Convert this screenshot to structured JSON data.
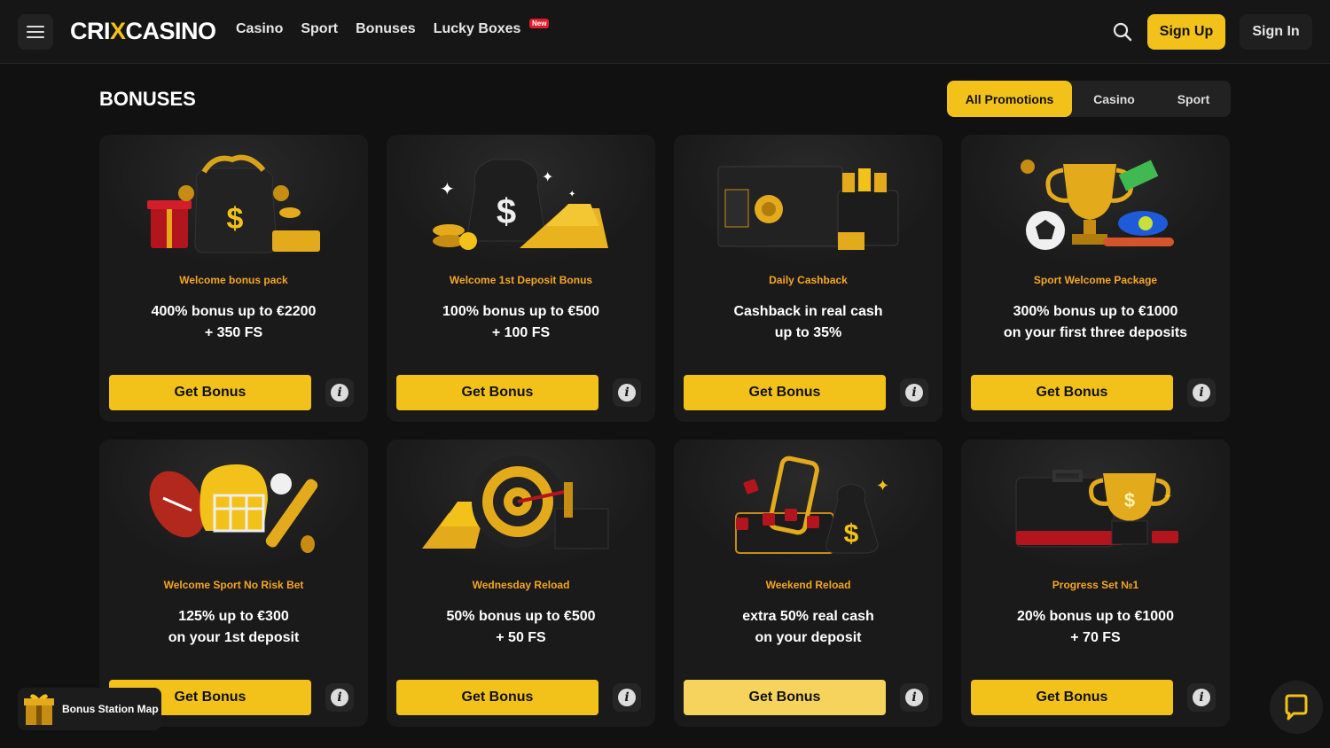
{
  "header": {
    "logo": {
      "part1": "CRI",
      "x": "X",
      "part2": "CASINO"
    },
    "nav": [
      {
        "label": "Casino"
      },
      {
        "label": "Sport"
      },
      {
        "label": "Bonuses"
      },
      {
        "label": "Lucky Boxes",
        "badge": "New"
      }
    ],
    "search_icon": "search-icon",
    "sign_up": "Sign Up",
    "sign_in": "Sign In"
  },
  "page": {
    "title": "BONUSES",
    "filters": [
      {
        "label": "All Promotions",
        "active": true
      },
      {
        "label": "Casino",
        "active": false
      },
      {
        "label": "Sport",
        "active": false
      }
    ]
  },
  "cards": [
    {
      "category": "Welcome bonus pack",
      "line1": "400% bonus up to €2200",
      "line2": "+ 350 FS",
      "button": "Get Bonus",
      "image": "money-bag-gift-icon"
    },
    {
      "category": "Welcome 1st Deposit Bonus",
      "line1": "100% bonus up to €500",
      "line2": "+ 100 FS",
      "button": "Get Bonus",
      "image": "money-bag-gold-bars-icon"
    },
    {
      "category": "Daily Cashback",
      "line1": "Cashback in real cash",
      "line2": "up to 35%",
      "button": "Get Bonus",
      "image": "safe-wallet-icon"
    },
    {
      "category": "Sport Welcome Package",
      "line1": "300% bonus up to €1000",
      "line2": "on your first three deposits",
      "button": "Get Bonus",
      "image": "trophy-sports-icon"
    },
    {
      "category": "Welcome Sport No Risk Bet",
      "line1": "125% up to €300",
      "line2": "on your 1st deposit",
      "button": "Get Bonus",
      "image": "football-helmet-icon"
    },
    {
      "category": "Wednesday Reload",
      "line1": "50% bonus up to €500",
      "line2": "+ 50 FS",
      "button": "Get Bonus",
      "image": "target-gold-icon"
    },
    {
      "category": "Weekend Reload",
      "line1": "extra 50% real cash",
      "line2": "on your deposit",
      "button": "Get Bonus",
      "image": "slot-coins-bag-icon"
    },
    {
      "category": "Progress Set №1",
      "line1": "20% bonus up to €1000",
      "line2": "+ 70 FS",
      "button": "Get Bonus",
      "image": "cup-briefcase-icon"
    }
  ],
  "floating": {
    "bonus_map": "Bonus Station Map",
    "chat_icon": "chat-icon"
  },
  "colors": {
    "accent": "#f2c21b",
    "category": "#f5a623",
    "background": "#111111",
    "card": "#1a1a1a"
  }
}
